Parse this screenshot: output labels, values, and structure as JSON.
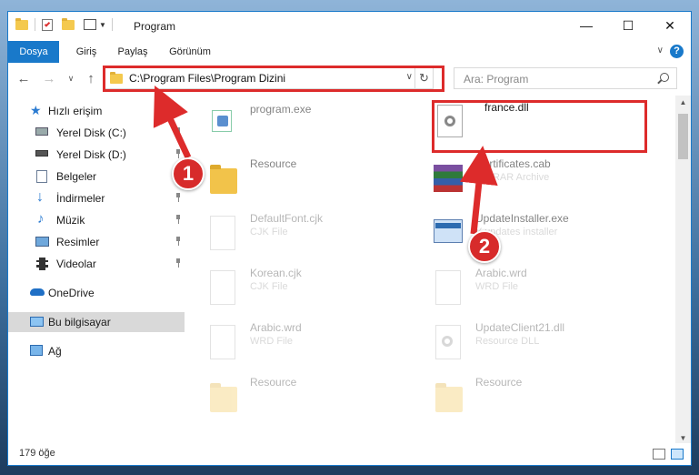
{
  "window": {
    "title": "Program",
    "controls": {
      "minimize": "—",
      "maximize": "☐",
      "close": "✕"
    }
  },
  "ribbon": {
    "tabs": [
      "Dosya",
      "Giriş",
      "Paylaş",
      "Görünüm"
    ],
    "help": "?"
  },
  "address_bar": {
    "path": "C:\\Program Files\\Program Dizini",
    "search_placeholder": "Ara: Program"
  },
  "sidebar": {
    "quick_access": "Hızlı erişim",
    "items": [
      {
        "label": "Yerel Disk (C:)",
        "icon": "drive-icon",
        "pinned": true
      },
      {
        "label": "Yerel Disk (D:)",
        "icon": "drive-icon",
        "pinned": true
      },
      {
        "label": "Belgeler",
        "icon": "documents-icon",
        "pinned": true
      },
      {
        "label": "İndirmeler",
        "icon": "download-icon",
        "pinned": true
      },
      {
        "label": "Müzik",
        "icon": "music-icon",
        "pinned": true
      },
      {
        "label": "Resimler",
        "icon": "pictures-icon",
        "pinned": true
      },
      {
        "label": "Videolar",
        "icon": "videos-icon",
        "pinned": true
      }
    ],
    "onedrive": "OneDrive",
    "this_pc": "Bu bilgisayar",
    "network": "Ağ"
  },
  "files": [
    {
      "name": "program.exe",
      "type": "",
      "icon": "exe-icon",
      "faded": false
    },
    {
      "name": "france.dll",
      "type": "",
      "icon": "dll-icon",
      "faded": false
    },
    {
      "name": "Resource",
      "type": "",
      "icon": "folder-icon",
      "faded": false
    },
    {
      "name": "Certificates.cab",
      "type": "WinRAR Archive",
      "icon": "archive-icon",
      "faded": true
    },
    {
      "name": "DefaultFont.cjk",
      "type": "CJK File",
      "icon": "file-icon",
      "faded": true
    },
    {
      "name": "UpdateInstaller.exe",
      "type": "Y updates installer",
      "icon": "installer-icon",
      "faded": true
    },
    {
      "name": "Korean.cjk",
      "type": "CJK File",
      "icon": "file-icon",
      "faded": true
    },
    {
      "name": "Arabic.wrd",
      "type": "WRD File",
      "icon": "file-icon",
      "faded": true
    },
    {
      "name": "Arabic.wrd",
      "type": "WRD File",
      "icon": "file-icon",
      "faded": true
    },
    {
      "name": "UpdateClient21.dll",
      "type": "Resource DLL",
      "icon": "dll-icon",
      "faded": true
    },
    {
      "name": "Resource",
      "type": "",
      "icon": "folder-icon",
      "faded": true
    },
    {
      "name": "Resource",
      "type": "",
      "icon": "folder-icon",
      "faded": true
    }
  ],
  "status_bar": {
    "count": "179 öğe"
  },
  "annotations": {
    "step1": "1",
    "step2": "2",
    "color": "#dd2b2b"
  }
}
